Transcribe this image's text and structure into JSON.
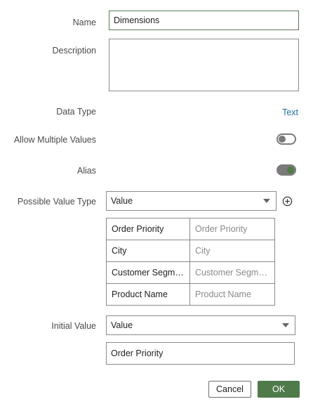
{
  "form": {
    "name_label": "Name",
    "name_value": "Dimensions",
    "description_label": "Description",
    "description_value": "",
    "data_type_label": "Data Type",
    "data_type_value": "Text",
    "allow_multiple_label": "Allow Multiple Values",
    "allow_multiple_on": false,
    "alias_label": "Alias",
    "alias_on": true,
    "possible_value_type_label": "Possible Value Type",
    "possible_value_type_selected": "Value",
    "add_icon": "plus-circle-icon",
    "values_table": [
      {
        "value": "Order Priority",
        "alias_placeholder": "Order Priority"
      },
      {
        "value": "City",
        "alias_placeholder": "City"
      },
      {
        "value": "Customer Segment",
        "alias_placeholder": "Customer Segment"
      },
      {
        "value": "Product Name",
        "alias_placeholder": "Product Name"
      }
    ],
    "initial_value_label": "Initial Value",
    "initial_value_type_selected": "Value",
    "initial_value": "Order Priority"
  },
  "footer": {
    "cancel_label": "Cancel",
    "ok_label": "OK"
  },
  "colors": {
    "accent": "#4f7a4a",
    "link": "#1f6f9a"
  }
}
